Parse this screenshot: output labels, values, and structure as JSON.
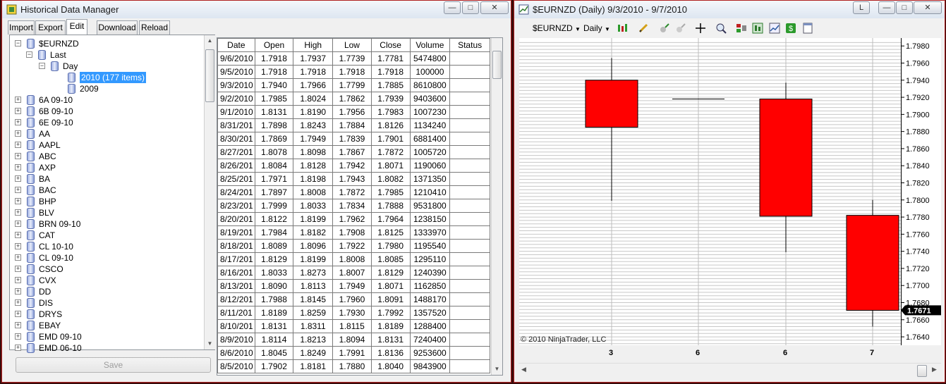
{
  "hdm": {
    "title": "Historical Data Manager",
    "tabs": [
      "Import",
      "Export",
      "Edit",
      "Download",
      "Reload"
    ],
    "active_tab": "Edit",
    "tree": {
      "root": "$EURNZD",
      "last": "Last",
      "day": "Day",
      "year_2010": "2010 (177 items)",
      "year_2009": "2009",
      "instruments": [
        "6A 09-10",
        "6B 09-10",
        "6E 09-10",
        "AA",
        "AAPL",
        "ABC",
        "AXP",
        "BA",
        "BAC",
        "BHP",
        "BLV",
        "BRN 09-10",
        "CAT",
        "CL 10-10",
        "CL 09-10",
        "CSCO",
        "CVX",
        "DD",
        "DIS",
        "DRYS",
        "EBAY",
        "EMD 09-10",
        "EMD 06-10"
      ]
    },
    "grid": {
      "columns": [
        "Date",
        "Open",
        "High",
        "Low",
        "Close",
        "Volume",
        "Status"
      ],
      "rows": [
        [
          "9/6/2010",
          "1.7918",
          "1.7937",
          "1.7739",
          "1.7781",
          "5474800",
          ""
        ],
        [
          "9/5/2010",
          "1.7918",
          "1.7918",
          "1.7918",
          "1.7918",
          "100000",
          ""
        ],
        [
          "9/3/2010",
          "1.7940",
          "1.7966",
          "1.7799",
          "1.7885",
          "8610800",
          ""
        ],
        [
          "9/2/2010",
          "1.7985",
          "1.8024",
          "1.7862",
          "1.7939",
          "9403600",
          ""
        ],
        [
          "9/1/2010",
          "1.8131",
          "1.8190",
          "1.7956",
          "1.7983",
          "1007230",
          ""
        ],
        [
          "8/31/201",
          "1.7898",
          "1.8243",
          "1.7884",
          "1.8126",
          "1134240",
          ""
        ],
        [
          "8/30/201",
          "1.7869",
          "1.7949",
          "1.7839",
          "1.7901",
          "6881400",
          ""
        ],
        [
          "8/27/201",
          "1.8078",
          "1.8098",
          "1.7867",
          "1.7872",
          "1005720",
          ""
        ],
        [
          "8/26/201",
          "1.8084",
          "1.8128",
          "1.7942",
          "1.8071",
          "1190060",
          ""
        ],
        [
          "8/25/201",
          "1.7971",
          "1.8198",
          "1.7943",
          "1.8082",
          "1371350",
          ""
        ],
        [
          "8/24/201",
          "1.7897",
          "1.8008",
          "1.7872",
          "1.7985",
          "1210410",
          ""
        ],
        [
          "8/23/201",
          "1.7999",
          "1.8033",
          "1.7834",
          "1.7888",
          "9531800",
          ""
        ],
        [
          "8/20/201",
          "1.8122",
          "1.8199",
          "1.7962",
          "1.7964",
          "1238150",
          ""
        ],
        [
          "8/19/201",
          "1.7984",
          "1.8182",
          "1.7908",
          "1.8125",
          "1333970",
          ""
        ],
        [
          "8/18/201",
          "1.8089",
          "1.8096",
          "1.7922",
          "1.7980",
          "1195540",
          ""
        ],
        [
          "8/17/201",
          "1.8129",
          "1.8199",
          "1.8008",
          "1.8085",
          "1295110",
          ""
        ],
        [
          "8/16/201",
          "1.8033",
          "1.8273",
          "1.8007",
          "1.8129",
          "1240390",
          ""
        ],
        [
          "8/13/201",
          "1.8090",
          "1.8113",
          "1.7949",
          "1.8071",
          "1162850",
          ""
        ],
        [
          "8/12/201",
          "1.7988",
          "1.8145",
          "1.7960",
          "1.8091",
          "1488170",
          ""
        ],
        [
          "8/11/201",
          "1.8189",
          "1.8259",
          "1.7930",
          "1.7992",
          "1357520",
          ""
        ],
        [
          "8/10/201",
          "1.8131",
          "1.8311",
          "1.8115",
          "1.8189",
          "1288400",
          ""
        ],
        [
          "8/9/2010",
          "1.8114",
          "1.8213",
          "1.8094",
          "1.8131",
          "7240400",
          ""
        ],
        [
          "8/6/2010",
          "1.8045",
          "1.8249",
          "1.7991",
          "1.8136",
          "9253600",
          ""
        ],
        [
          "8/5/2010",
          "1.7902",
          "1.8181",
          "1.7880",
          "1.8040",
          "9843900",
          ""
        ]
      ]
    },
    "save_label": "Save"
  },
  "chart_window": {
    "title": "$EURNZD (Daily)  9/3/2010 - 9/7/2010",
    "instrument": "$EURNZD",
    "period": "Daily",
    "copyright": "© 2010 NinjaTrader, LLC",
    "caption_letter": "L"
  },
  "chart_data": {
    "type": "candlestick",
    "x_labels": [
      "3",
      "6",
      "6",
      "7"
    ],
    "candles": [
      {
        "label": "3",
        "open": 1.794,
        "high": 1.7966,
        "low": 1.7799,
        "close": 1.7885
      },
      {
        "label": "6",
        "open": 1.7918,
        "high": 1.7918,
        "low": 1.7918,
        "close": 1.7918
      },
      {
        "label": "6",
        "open": 1.7918,
        "high": 1.7937,
        "low": 1.7739,
        "close": 1.7781
      },
      {
        "label": "7",
        "open": 1.7782,
        "high": 1.78,
        "low": 1.7652,
        "close": 1.7671
      }
    ],
    "y_ticks": [
      "1.7640",
      "1.7660",
      "1.7680",
      "1.7700",
      "1.7720",
      "1.7740",
      "1.7760",
      "1.7780",
      "1.7800",
      "1.7820",
      "1.7840",
      "1.7860",
      "1.7880",
      "1.7900",
      "1.7920",
      "1.7940",
      "1.7960",
      "1.7980"
    ],
    "ylim": [
      1.7631,
      1.7988
    ],
    "last_price": "1.7671",
    "colors": {
      "down_body": "#ff0000",
      "wick": "#000000",
      "grid": "#c8c8c8",
      "price_tag": "#000000"
    }
  }
}
